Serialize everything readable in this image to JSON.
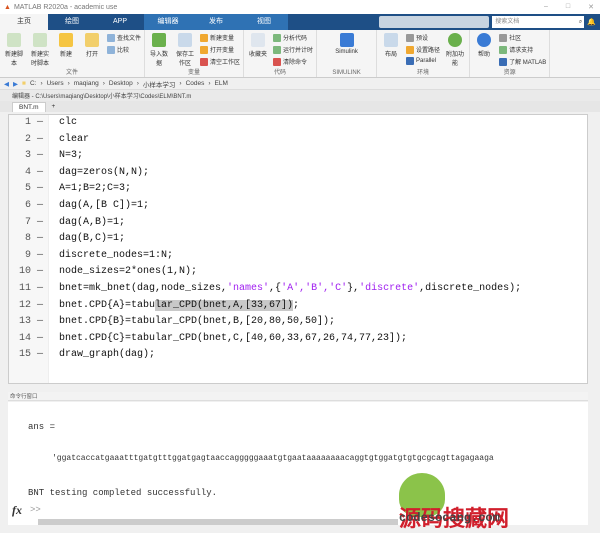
{
  "window": {
    "title": "MATLAB R2020a - academic use"
  },
  "tabs": [
    {
      "label": "主页"
    },
    {
      "label": "绘图"
    },
    {
      "label": "APP"
    },
    {
      "label": "编辑器"
    },
    {
      "label": "发布"
    },
    {
      "label": "视图"
    }
  ],
  "search": {
    "placeholder": "搜索文档"
  },
  "ribbon": {
    "file": {
      "label": "文件",
      "new_script": "新建脚本",
      "new_live": "新建实时脚本",
      "new": "新建",
      "open": "打开",
      "find_files": "查找文件",
      "compare": "比较"
    },
    "variable": {
      "label": "变量",
      "import": "导入数据",
      "save_ws": "保存工作区",
      "new_var": "新建变量",
      "open_var": "打开变量",
      "clear_ws": "清空工作区"
    },
    "code": {
      "label": "代码",
      "favorites": "收藏夹",
      "analyze": "分析代码",
      "run_time": "运行并计时",
      "clear_cmds": "清除命令"
    },
    "simulink": {
      "label": "SIMULINK",
      "simulink": "Simulink"
    },
    "env": {
      "label": "环境",
      "layout": "布局",
      "prefs": "预设",
      "set_path": "设置路径",
      "parallel": "Parallel",
      "addons": "附加功能"
    },
    "resources": {
      "label": "资源",
      "help": "帮助",
      "community": "社区",
      "support": "请求支持",
      "learn": "了解 MATLAB"
    }
  },
  "path": [
    "C:",
    "Users",
    "maqiang",
    "Desktop",
    "小样本学习",
    "Codes",
    "ELM"
  ],
  "editor": {
    "title": "编辑器 - C:\\Users\\maqiang\\Desktop\\小样本学习\\Codes\\ELM\\BNT.m",
    "tab": "BNT.m",
    "add_tab": "+"
  },
  "code_lines": [
    {
      "n": "1",
      "t": "clc"
    },
    {
      "n": "2",
      "t": "clear"
    },
    {
      "n": "3",
      "t": "N=3;"
    },
    {
      "n": "4",
      "t": "dag=zeros(N,N);"
    },
    {
      "n": "5",
      "t": "A=1;B=2;C=3;"
    },
    {
      "n": "6",
      "t": "dag(A,[B C])=1;"
    },
    {
      "n": "7",
      "t": "dag(A,B)=1;"
    },
    {
      "n": "8",
      "t": "dag(B,C)=1;"
    },
    {
      "n": "9",
      "t": "discrete_nodes=1:N;"
    },
    {
      "n": "10",
      "t": "node_sizes=2*ones(1,N);"
    },
    {
      "n": "11",
      "a": "bnet=mk_bnet(dag,node_sizes,",
      "s1": "'names'",
      "b": ",{",
      "s2": "'A','B','C'",
      "c": "},",
      "s3": "'discrete'",
      "d": ",discrete_nodes);"
    },
    {
      "n": "12",
      "a": "bnet.CPD{A}=tabu",
      "h": "lar_CPD(bnet,A,[33,67])",
      "d": ";"
    },
    {
      "n": "13",
      "t": "bnet.CPD{B}=tabular_CPD(bnet,B,[20,80,50,50]);"
    },
    {
      "n": "14",
      "t": "bnet.CPD{C}=tabular_CPD(bnet,C,[40,60,33,67,26,74,77,23]);"
    },
    {
      "n": "15",
      "t": "draw_graph(dag);"
    }
  ],
  "command": {
    "header": "命令行窗口",
    "ans": "ans =",
    "seq": "'ggatcaccatgaaatttgatgtttggatgagtaaccagggggaaatgtgaataaaaaaaacaggtgtggatgtgtgcgcagttagagaaga",
    "msg": "BNT testing completed successfully.",
    "fx": "fx",
    "prompt": ">>"
  },
  "watermark": {
    "cn": "源码搜藏网",
    "en": "codesocang.com"
  }
}
